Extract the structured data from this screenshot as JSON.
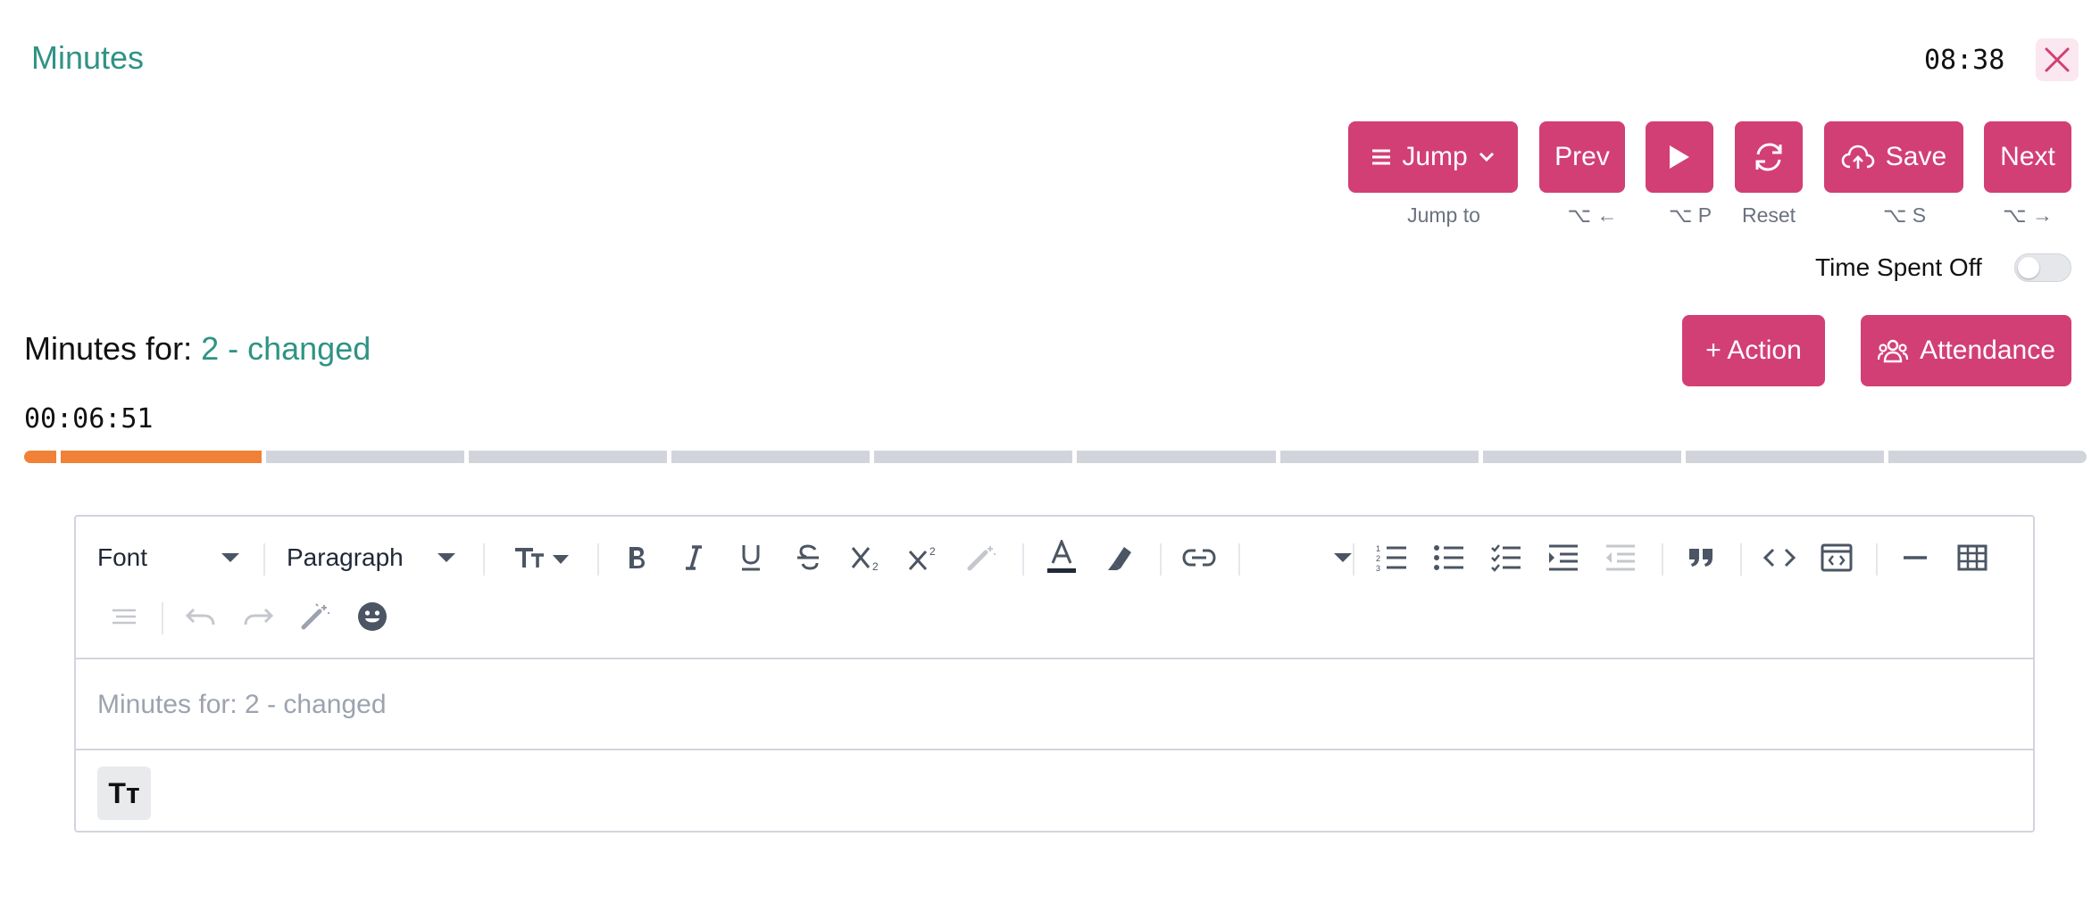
{
  "header": {
    "title": "Minutes",
    "clock": "08:38"
  },
  "controls": {
    "jump": {
      "label": "Jump",
      "hint": "Jump to"
    },
    "prev": {
      "label": "Prev",
      "hint": "⌥ ←"
    },
    "play": {
      "hint": "⌥ P"
    },
    "reset": {
      "hint": "Reset"
    },
    "save": {
      "label": "Save",
      "hint": "⌥ S"
    },
    "next": {
      "label": "Next",
      "hint": "⌥ →"
    }
  },
  "time_spent": {
    "label": "Time Spent Off",
    "enabled": false
  },
  "section": {
    "prefix": "Minutes for:",
    "item": "2 - changed",
    "elapsed": "00:06:51",
    "action_label": "+ Action",
    "attendance_label": "Attendance"
  },
  "progress": {
    "segments": 10,
    "completed": 1,
    "partial_first": true
  },
  "editor": {
    "font_label": "Font",
    "block_label": "Paragraph",
    "placeholder": "Minutes for: 2 - changed",
    "footer_icon": "Tт"
  },
  "colors": {
    "accent": "#d23f74",
    "teal": "#2f9384",
    "progress": "#f08137",
    "track": "#d1d5db"
  }
}
